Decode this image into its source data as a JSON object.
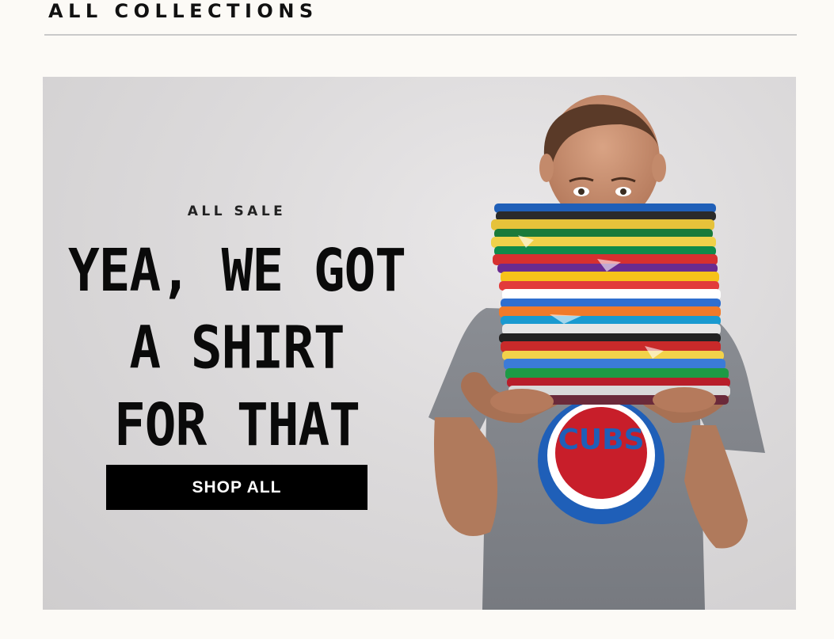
{
  "collections": {
    "heading": "ALL COLLECTIONS"
  },
  "hero": {
    "eyebrow": "ALL SALE",
    "headline_lines": [
      "YEA, WE GOT",
      "A SHIRT",
      "FOR THAT"
    ],
    "cta_label": "SHOP ALL",
    "photo_description": "Man holding a tall stack of folded colorful sports t-shirts up to his face",
    "shirt_print": "CUBS",
    "colors": {
      "background": "#fcfaf6",
      "button": "#000000",
      "button_text": "#ffffff",
      "headline": "#0a0a0a"
    }
  }
}
